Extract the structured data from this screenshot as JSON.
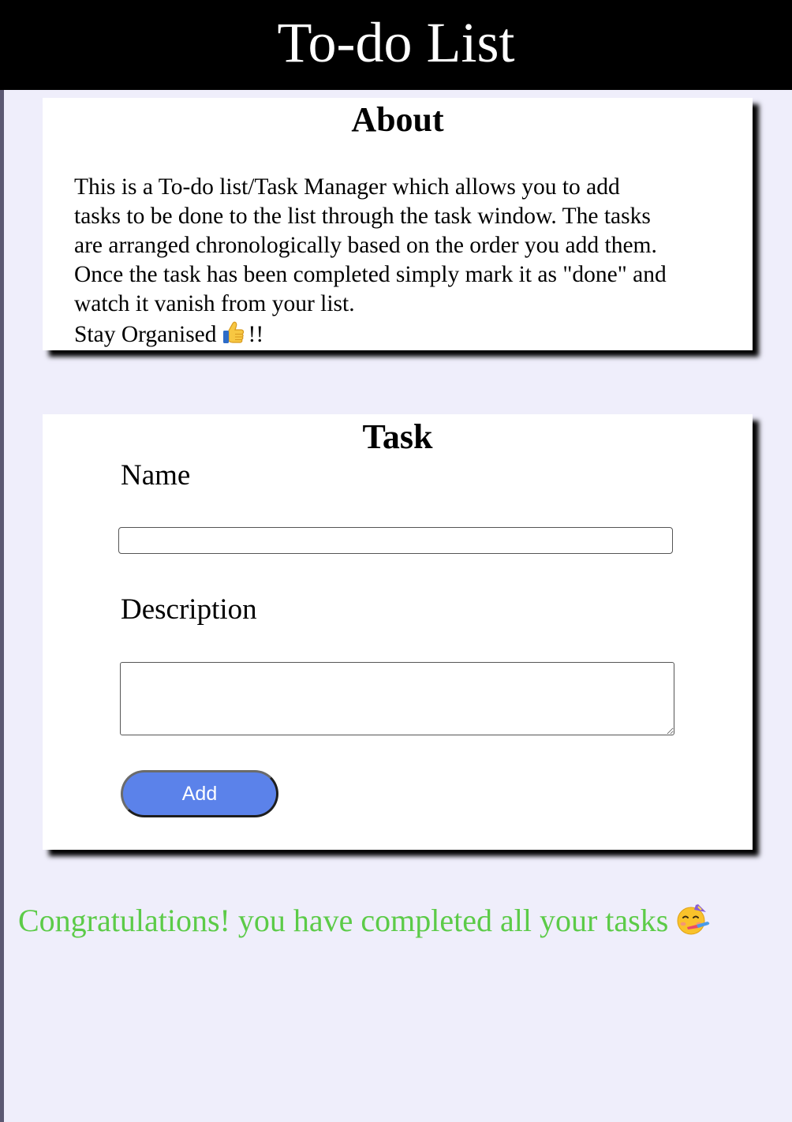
{
  "header": {
    "title": "To-do List"
  },
  "about": {
    "heading": "About",
    "lines": [
      "This is a To-do list/Task Manager which allows you to add",
      "tasks to be done to the list through the task window. The tasks",
      "are arranged chronologically based on the order you add them.",
      "Once the task has been completed simply mark it as \"done\" and",
      "watch it vanish from your list."
    ],
    "stay_prefix": "Stay Organised",
    "stay_icon": "thumbs-up-icon",
    "stay_suffix": "!!"
  },
  "task_form": {
    "heading": "Task",
    "name_label": "Name",
    "name_value": "",
    "description_label": "Description",
    "description_value": "",
    "add_button_label": "Add"
  },
  "congrats": {
    "text": "Congratulations! you have completed all your tasks",
    "icon": "party-face-icon"
  },
  "colors": {
    "header_bg": "#000000",
    "page_bg": "#efeefb",
    "button_bg": "#5b82ea",
    "congrats_text": "#5ccb48"
  }
}
